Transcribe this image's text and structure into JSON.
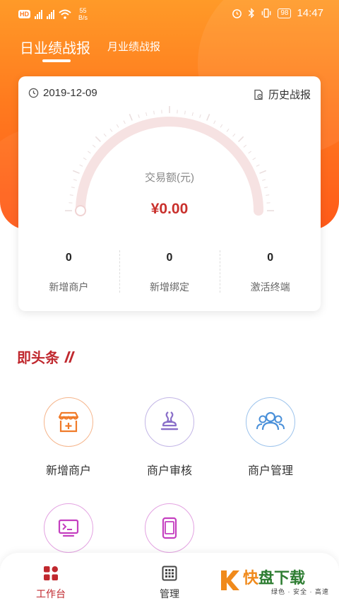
{
  "status_bar": {
    "network_badge": "HD",
    "net_speed_value": "55",
    "net_speed_unit": "B/s",
    "battery": "98",
    "time": "14:47"
  },
  "tabs": {
    "daily": "日业绩战报",
    "monthly": "月业绩战报"
  },
  "summary_card": {
    "date": "2019-12-09",
    "history_link": "历史战报",
    "amount_label": "交易额(元)",
    "amount_value": "¥0.00",
    "gauge_progress": 0,
    "stats": [
      {
        "value": "0",
        "label": "新增商户"
      },
      {
        "value": "0",
        "label": "新增绑定"
      },
      {
        "value": "0",
        "label": "激活终端"
      }
    ]
  },
  "headline": {
    "title": "即头条"
  },
  "grid": [
    {
      "label": "新增商户",
      "icon": "store-add-icon",
      "color": "#f07b2a"
    },
    {
      "label": "商户审核",
      "icon": "stamp-icon",
      "color": "#8a6fc9"
    },
    {
      "label": "商户管理",
      "icon": "users-icon",
      "color": "#4a90d9"
    },
    {
      "label": "",
      "icon": "terminal-icon",
      "color": "#c43fc0"
    },
    {
      "label": "",
      "icon": "device-icon",
      "color": "#c43fc0"
    }
  ],
  "bottom_nav": {
    "workbench": "工作台",
    "manage": "管理"
  },
  "watermark": {
    "brand_a": "快",
    "brand_b": "盘下载",
    "tagline": "绿色 · 安全 · 高速"
  },
  "colors": {
    "accent": "#ff7a1e",
    "brand_red": "#c0282e"
  }
}
